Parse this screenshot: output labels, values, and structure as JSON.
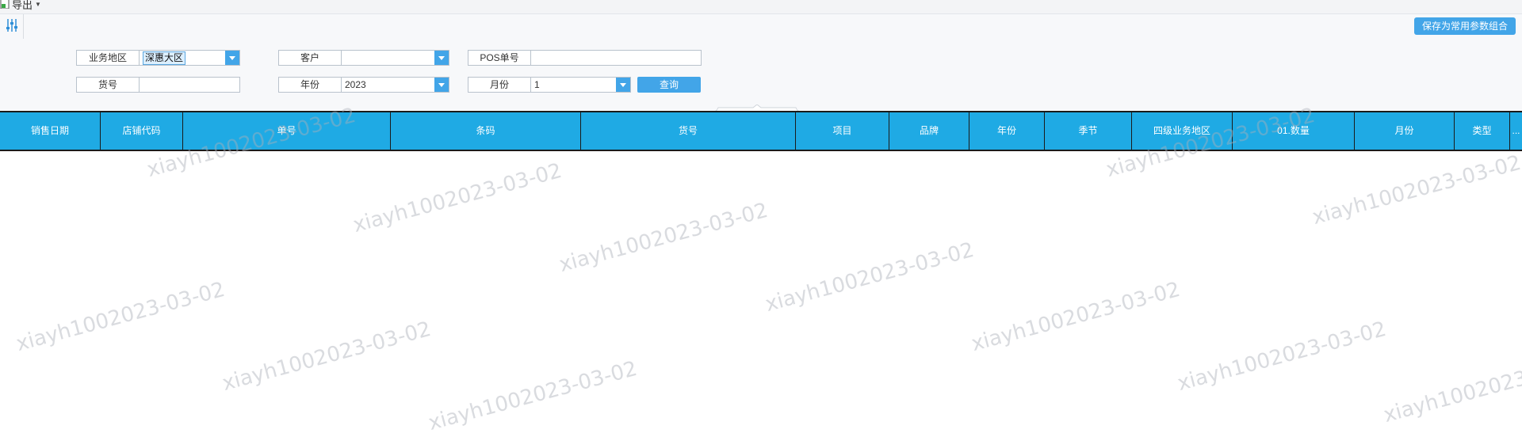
{
  "toolbar": {
    "export_label": "导出",
    "save_combo_label": "保存为常用参数组合"
  },
  "filters": {
    "region": {
      "label": "业务地区",
      "value": "深惠大区"
    },
    "customer": {
      "label": "客户",
      "value": ""
    },
    "pos_no": {
      "label": "POS单号",
      "value": ""
    },
    "item_no": {
      "label": "货号",
      "value": ""
    },
    "year": {
      "label": "年份",
      "value": "2023"
    },
    "month": {
      "label": "月份",
      "value": "1"
    },
    "query_label": "查询"
  },
  "grid": {
    "columns": [
      "销售日期",
      "店铺代码",
      "单号",
      "条码",
      "货号",
      "项目",
      "品牌",
      "年份",
      "季节",
      "四级业务地区",
      "01.数量",
      "月份",
      "类型",
      "..."
    ]
  },
  "watermark": {
    "text": "xiayh1002023-03-02"
  },
  "colors": {
    "accent": "#42a5e8",
    "header_bg": "#1faae4"
  }
}
